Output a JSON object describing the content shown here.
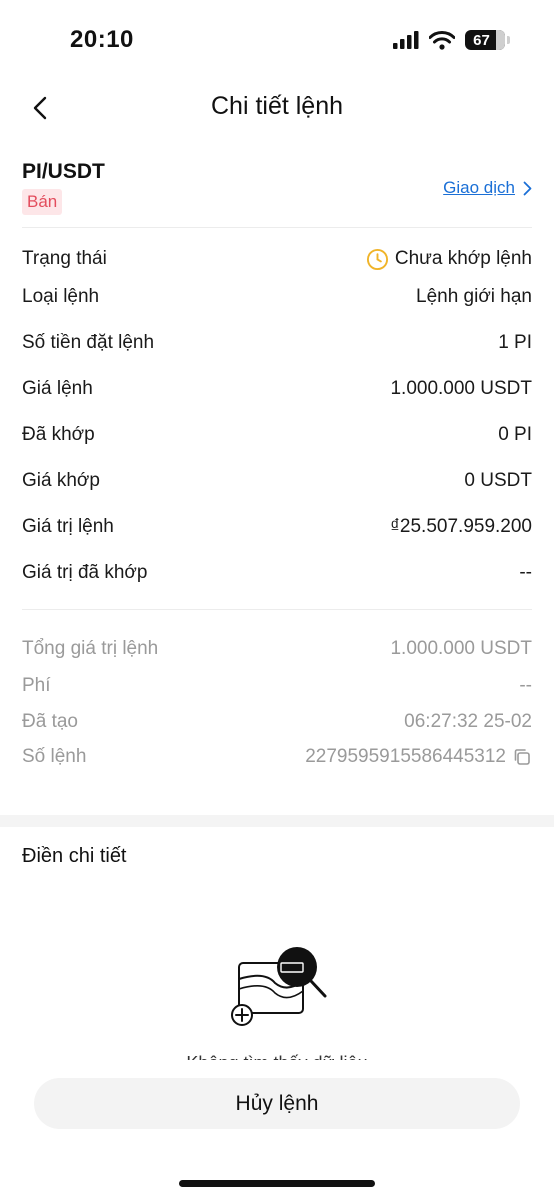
{
  "status_bar": {
    "time": "20:10",
    "battery": "67"
  },
  "nav": {
    "title": "Chi tiết lệnh"
  },
  "order": {
    "pair": "PI/USDT",
    "side": "Bán",
    "trade_link": "Giao dịch"
  },
  "details": [
    {
      "label": "Trạng thái",
      "value": "Chưa khớp lệnh"
    },
    {
      "label": "Loại lệnh",
      "value": "Lệnh giới hạn"
    },
    {
      "label": "Số tiền đặt lệnh",
      "value": "1 PI"
    },
    {
      "label": "Giá lệnh",
      "value": "1.000.000 USDT"
    },
    {
      "label": "Đã khớp",
      "value": "0 PI"
    },
    {
      "label": "Giá khớp",
      "value": "0 USDT"
    },
    {
      "label": "Giá trị lệnh",
      "value": "₫25.507.959.200"
    },
    {
      "label": "Giá trị đã khớp",
      "value": "--"
    }
  ],
  "summary": [
    {
      "label": "Tổng giá trị lệnh",
      "value": "1.000.000 USDT"
    },
    {
      "label": "Phí",
      "value": "--"
    },
    {
      "label": "Đã tạo",
      "value": "06:27:32 25-02"
    },
    {
      "label": "Số lệnh",
      "value": "2279595915586445312"
    }
  ],
  "fill_section": {
    "title": "Điền chi tiết",
    "empty_text": "Không tìm thấy dữ liệu"
  },
  "actions": {
    "cancel_label": "Hủy lệnh"
  },
  "colors": {
    "sell": "#e34d5d",
    "sell_bg": "#fde6e8",
    "link": "#1a6fd6",
    "pending": "#f0b429",
    "muted": "#9a9a9a"
  }
}
